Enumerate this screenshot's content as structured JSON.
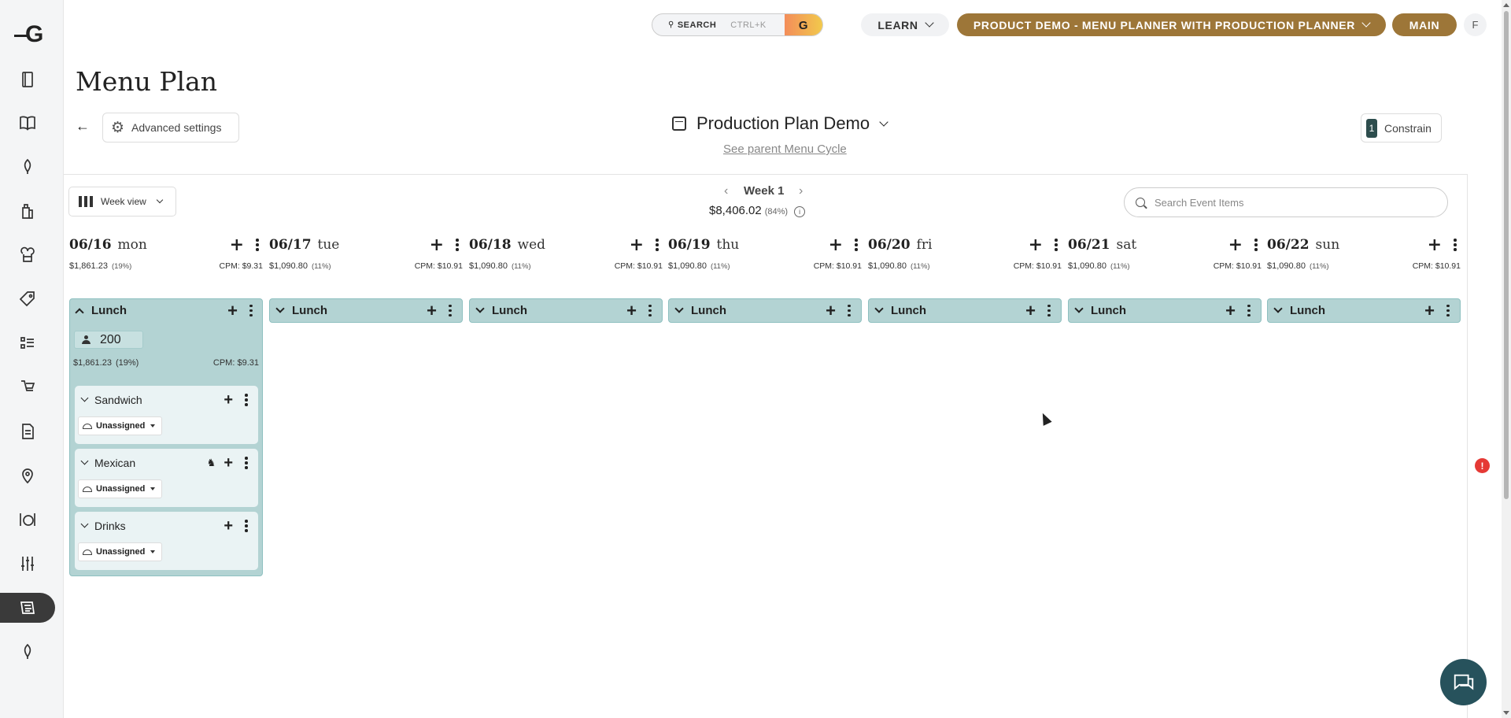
{
  "topbar": {
    "search_label": "SEARCH",
    "search_shortcut": "CTRL+K",
    "learn_label": "LEARN",
    "project_label": "PRODUCT DEMO - MENU PLANNER WITH PRODUCTION PLANNER",
    "branch_label": "MAIN",
    "user_initial": "F",
    "accent_color": "#9d7638"
  },
  "sidebar": {
    "items": [
      "recipes-icon",
      "book-icon",
      "ingredient-icon",
      "inventory-icon",
      "kitchen-icon",
      "tag-icon",
      "checklist-icon",
      "order-icon",
      "document-icon",
      "location-icon",
      "dining-icon",
      "settings-sliders-icon",
      "menu-plan-icon",
      "ingredient-2-icon"
    ],
    "active": "menu-plan-icon"
  },
  "page": {
    "title": "Menu Plan",
    "advanced_settings": "Advanced settings",
    "plan_name": "Production Plan Demo",
    "parent_link": "See parent Menu Cycle",
    "constrain_count": "1",
    "constrain_label": "Constrain"
  },
  "toolbar": {
    "view_label": "Week view",
    "week_label": "Week 1",
    "week_total": "$8,406.02",
    "week_pct": "(84%)",
    "search_placeholder": "Search Event Items"
  },
  "days": [
    {
      "date": "06/16",
      "dow": "mon",
      "cost": "$1,861.23",
      "pct": "(19%)",
      "cpm": "CPM:  $9.31",
      "meal": "Lunch"
    },
    {
      "date": "06/17",
      "dow": "tue",
      "cost": "$1,090.80",
      "pct": "(11%)",
      "cpm": "CPM:  $10.91",
      "meal": "Lunch"
    },
    {
      "date": "06/18",
      "dow": "wed",
      "cost": "$1,090.80",
      "pct": "(11%)",
      "cpm": "CPM:  $10.91",
      "meal": "Lunch"
    },
    {
      "date": "06/19",
      "dow": "thu",
      "cost": "$1,090.80",
      "pct": "(11%)",
      "cpm": "CPM:  $10.91",
      "meal": "Lunch"
    },
    {
      "date": "06/20",
      "dow": "fri",
      "cost": "$1,090.80",
      "pct": "(11%)",
      "cpm": "CPM:  $10.91",
      "meal": "Lunch"
    },
    {
      "date": "06/21",
      "dow": "sat",
      "cost": "$1,090.80",
      "pct": "(11%)",
      "cpm": "CPM:  $10.91",
      "meal": "Lunch"
    },
    {
      "date": "06/22",
      "dow": "sun",
      "cost": "$1,090.80",
      "pct": "(11%)",
      "cpm": "CPM:  $10.91",
      "meal": "Lunch"
    }
  ],
  "expanded_meal": {
    "guests": "200",
    "cost": "$1,861.23",
    "pct": "(19%)",
    "cpm": "CPM:  $9.31",
    "categories": [
      {
        "name": "Sandwich",
        "assignee": "Unassigned"
      },
      {
        "name": "Mexican",
        "assignee": "Unassigned"
      },
      {
        "name": "Drinks",
        "assignee": "Unassigned"
      }
    ]
  },
  "alert_badge": "!"
}
